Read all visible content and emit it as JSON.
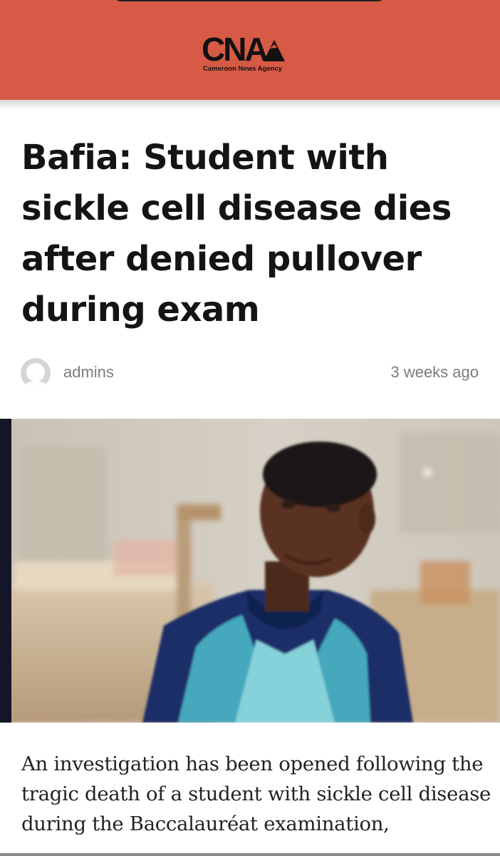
{
  "header": {
    "logo_text": "CNA",
    "logo_subtitle": "Cameroon News Agency",
    "background_color": "#d65a45"
  },
  "article": {
    "title": "Bafia: Student with sickle cell disease dies after denied pullover during exam",
    "author": "admins",
    "published": "3 weeks ago",
    "avatar_icon": "user-avatar-icon",
    "photo_icon": "article-photo",
    "body": "An investigation has been opened following the tragic death of a student with sickle cell disease during the Baccalauréat examination,"
  }
}
